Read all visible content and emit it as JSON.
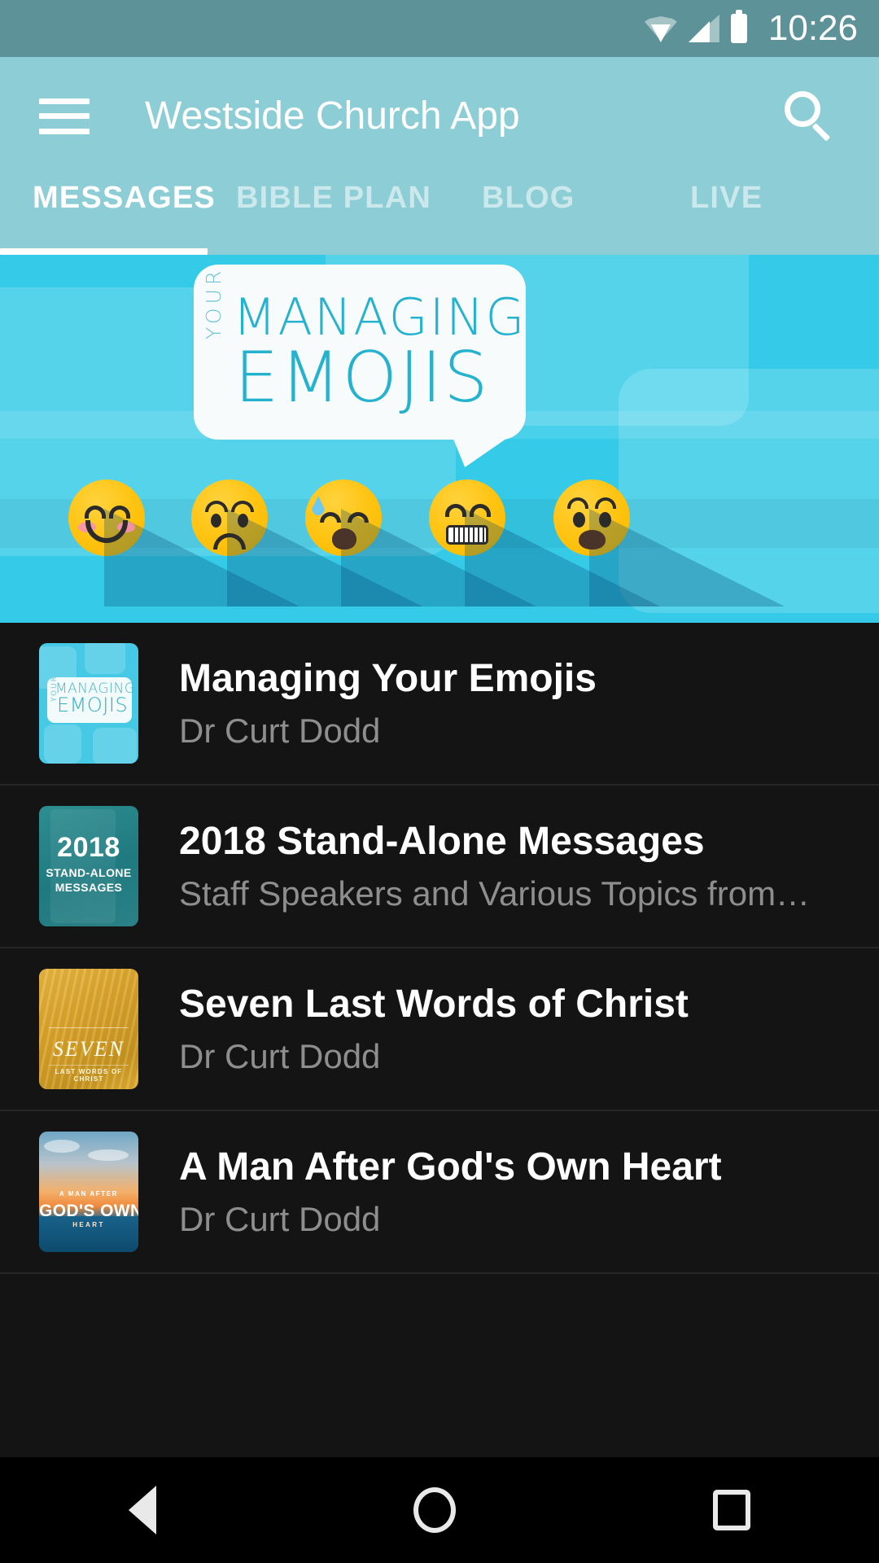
{
  "status_bar": {
    "time": "10:26",
    "icons": [
      "wifi-icon",
      "cell-signal-icon",
      "battery-icon"
    ]
  },
  "app_bar": {
    "menu_icon": "hamburger-menu-icon",
    "title": "Westside Church App",
    "search_icon": "search-icon",
    "background": "#8ccdd6"
  },
  "tabs": {
    "items": [
      {
        "label": "MESSAGES",
        "active": true
      },
      {
        "label": "BIBLE PLAN",
        "active": false
      },
      {
        "label": "BLOG",
        "active": false
      },
      {
        "label": "LIVE",
        "active": false
      }
    ],
    "indicator_color": "#ffffff"
  },
  "hero": {
    "title_line1": "MANAGING",
    "title_small": "YOUR",
    "title_line2": "EMOJIS",
    "background": "#35cbe8",
    "accent": "#25b2cf",
    "emojis": [
      "smiling-face-with-blush-emoji",
      "unamused-frowning-face-emoji",
      "sad-face-with-sweat-emoji",
      "grimacing-face-emoji",
      "anguished-open-mouth-face-emoji"
    ]
  },
  "list": {
    "items": [
      {
        "title": "Managing Your Emojis",
        "subtitle": "Dr Curt Dodd",
        "thumb": "managing-your-emojis-artwork",
        "thumb_text": {
          "line1": "MANAGING",
          "line2": "EMOJIS",
          "small": "YOUR"
        }
      },
      {
        "title": "2018 Stand-Alone Messages",
        "subtitle": "Staff Speakers and Various Topics from…",
        "thumb": "2018-stand-alone-messages-artwork",
        "thumb_text": {
          "year": "2018",
          "line1": "STAND-ALONE",
          "line2": "MESSAGES"
        }
      },
      {
        "title": "Seven Last Words of Christ",
        "subtitle": "Dr Curt Dodd",
        "thumb": "seven-last-words-of-christ-artwork",
        "thumb_text": {
          "word": "SEVEN",
          "sub": "LAST WORDS OF CHRIST"
        }
      },
      {
        "title": "A Man After God's Own Heart",
        "subtitle": "Dr Curt Dodd",
        "thumb": "a-man-after-gods-own-heart-artwork",
        "thumb_text": {
          "top": "A MAN AFTER",
          "mid": "GOD'S OWN",
          "bot": "HEART"
        }
      }
    ]
  },
  "nav_bar": {
    "back": "back-nav-icon",
    "home": "home-nav-icon",
    "recents": "recents-nav-icon"
  }
}
